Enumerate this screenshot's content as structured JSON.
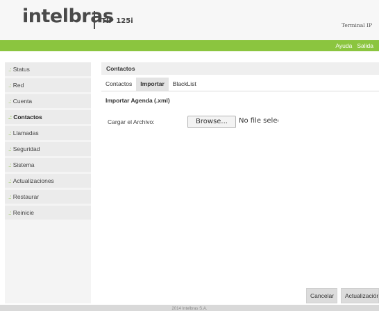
{
  "header": {
    "brand": "intelbras",
    "product": "TIP 125i",
    "terminal": "Terminal IP"
  },
  "topnav": {
    "help": "Ayuda",
    "logout": "Salida"
  },
  "sidebar": {
    "items": [
      {
        "label": "Status"
      },
      {
        "label": "Red"
      },
      {
        "label": "Cuenta"
      },
      {
        "label": "Contactos"
      },
      {
        "label": "Llamadas"
      },
      {
        "label": "Seguridad"
      },
      {
        "label": "Sistema"
      },
      {
        "label": "Actualizaciones"
      },
      {
        "label": "Restaurar"
      },
      {
        "label": "Reinicie"
      }
    ],
    "active_index": 3,
    "bullet": ".:"
  },
  "main": {
    "breadcrumb": "Contactos",
    "tabs": [
      {
        "label": "Contactos"
      },
      {
        "label": "Importar"
      },
      {
        "label": "BlackList"
      }
    ],
    "active_tab": 1,
    "section_title": "Importar Agenda (.xml)",
    "upload": {
      "label": "Cargar el Archivo:",
      "browse": "Browse...",
      "file_status": "No file selected."
    },
    "buttons": {
      "cancel": "Cancelar",
      "update": "Actualización"
    }
  },
  "footer": {
    "text": "2014 Intelbras S.A."
  },
  "colors": {
    "accent": "#8bc53f",
    "header_bg": "#f7f7f7",
    "sidebar_bg": "#ebebeb"
  }
}
